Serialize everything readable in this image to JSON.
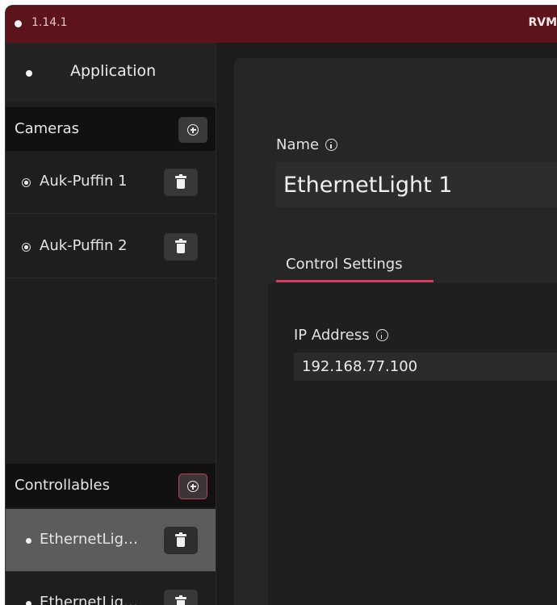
{
  "titlebar": {
    "version": "1.14.1",
    "title": "RVM"
  },
  "sidebar": {
    "application": {
      "label": "Application"
    },
    "cameras": {
      "header": "Cameras",
      "items": [
        {
          "label": "Auk-Puffin 1"
        },
        {
          "label": "Auk-Puffin 2"
        }
      ]
    },
    "controllables": {
      "header": "Controllables",
      "items": [
        {
          "label": "EthernetLig…",
          "selected": true
        },
        {
          "label": "EthernetLig…",
          "selected": false
        }
      ]
    }
  },
  "main": {
    "name_label": "Name",
    "name_value": "EthernetLight 1",
    "tab_label": "Control Settings",
    "ip_label": "IP Address",
    "ip_value": "192.168.77.100"
  },
  "colors": {
    "titlebar_bg": "#5c1319",
    "accent": "#d93a63",
    "selected_item_bg": "#5c5c5c"
  },
  "icons": {
    "add": "plus-circle-icon",
    "delete": "trash-icon",
    "info": "info-icon",
    "radio": "radio-icon"
  }
}
